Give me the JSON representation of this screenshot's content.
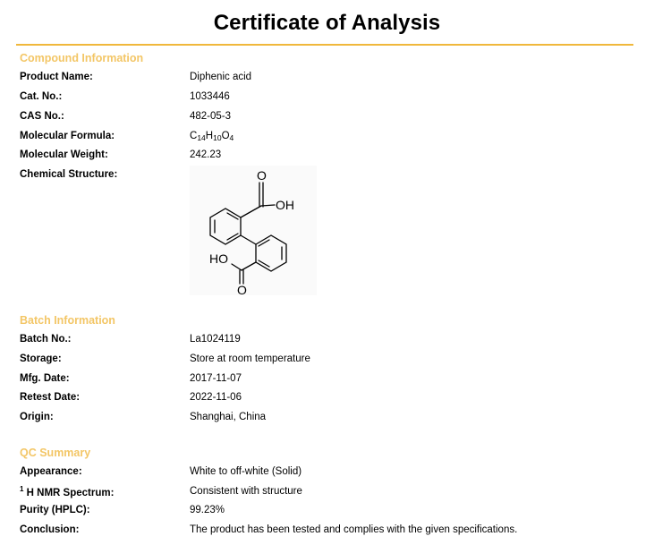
{
  "document": {
    "title": "Certificate of Analysis"
  },
  "compound": {
    "section_title": "Compound Information",
    "product_name_label": "Product Name:",
    "product_name": "Diphenic acid",
    "cat_no_label": "Cat. No.:",
    "cat_no": "1033446",
    "cas_no_label": "CAS No.:",
    "cas_no": "482-05-3",
    "formula_label": "Molecular Formula:",
    "formula": {
      "c": "C",
      "c_count": "14",
      "h": "H",
      "h_count": "10",
      "o": "O",
      "o_count": "4"
    },
    "mw_label": "Molecular Weight:",
    "mw": "242.23",
    "structure_label": "Chemical Structure:",
    "structure_atoms": {
      "top_o": "O",
      "top_oh": "OH",
      "bottom_ho": "HO",
      "bottom_o": "O"
    }
  },
  "batch": {
    "section_title": "Batch Information",
    "batch_no_label": "Batch No.:",
    "batch_no": "La1024119",
    "storage_label": "Storage:",
    "storage": "Store at room temperature",
    "mfg_label": "Mfg. Date:",
    "mfg": "2017-11-07",
    "retest_label": "Retest Date:",
    "retest": "2022-11-06",
    "origin_label": "Origin:",
    "origin": "Shanghai, China"
  },
  "qc": {
    "section_title": "QC Summary",
    "appearance_label": "Appearance:",
    "appearance": "White to off-white (Solid)",
    "nmr_label_sup": "1",
    "nmr_label": " H NMR Spectrum:",
    "nmr": "Consistent with structure",
    "purity_label": "Purity (HPLC):",
    "purity": "99.23%",
    "conclusion_label": "Conclusion:",
    "conclusion": "The product has been tested and complies with the given specifications."
  },
  "colors": {
    "accent": "#f0b83c",
    "section_heading": "#f3c666"
  }
}
